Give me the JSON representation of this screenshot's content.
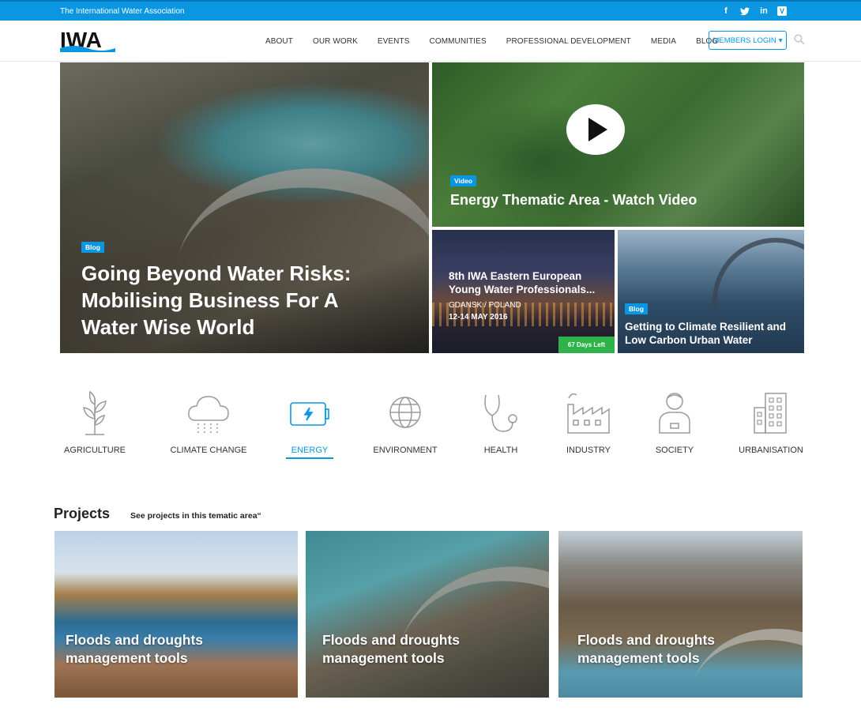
{
  "topbar": {
    "org_name": "The International Water Association",
    "social": [
      {
        "icon": "facebook-icon",
        "glyph": "f"
      },
      {
        "icon": "twitter-icon",
        "glyph": "t"
      },
      {
        "icon": "linkedin-icon",
        "glyph": "in"
      },
      {
        "icon": "vimeo-icon",
        "glyph": "V"
      }
    ]
  },
  "header": {
    "logo_text": "IWA",
    "nav": [
      "ABOUT",
      "OUR WORK",
      "EVENTS",
      "COMMUNITIES",
      "PROFESSIONAL DEVELOPMENT",
      "MEDIA",
      "BLOG"
    ],
    "login_label": "MEMBERS LOGIN",
    "login_caret": "▾"
  },
  "hero": {
    "main": {
      "badge": "Blog",
      "title": "Going Beyond Water Risks: Mobilising Business For A Water Wise World"
    },
    "video": {
      "badge": "Video",
      "title": "Energy Thematic Area - Watch Video"
    },
    "event": {
      "title": "8th IWA Eastern European Young Water Professionals...",
      "location": "GDANSK / POLAND",
      "date": "12-14 MAY 2016",
      "days_left": "67 Days Left"
    },
    "blog2": {
      "badge": "Blog",
      "title": "Getting to Climate Resilient and Low Carbon Urban Water"
    }
  },
  "themes": [
    {
      "label": "AGRICULTURE",
      "icon": "plant-icon"
    },
    {
      "label": "CLIMATE CHANGE",
      "icon": "cloud-rain-icon"
    },
    {
      "label": "ENERGY",
      "icon": "battery-icon",
      "active": true
    },
    {
      "label": "ENVIRONMENT",
      "icon": "globe-icon"
    },
    {
      "label": "HEALTH",
      "icon": "stethoscope-icon"
    },
    {
      "label": "INDUSTRY",
      "icon": "factory-icon"
    },
    {
      "label": "SOCIETY",
      "icon": "person-icon"
    },
    {
      "label": "URBANISATION",
      "icon": "building-icon"
    }
  ],
  "projects": {
    "heading": "Projects",
    "subheading": "See projects in this tematic area“",
    "cards": [
      {
        "title": "Floods and droughts management tools"
      },
      {
        "title": "Floods and droughts management tools"
      },
      {
        "title": "Floods and droughts management tools"
      }
    ]
  },
  "colors": {
    "accent": "#0a96e0",
    "days_left": "#2db34a"
  }
}
